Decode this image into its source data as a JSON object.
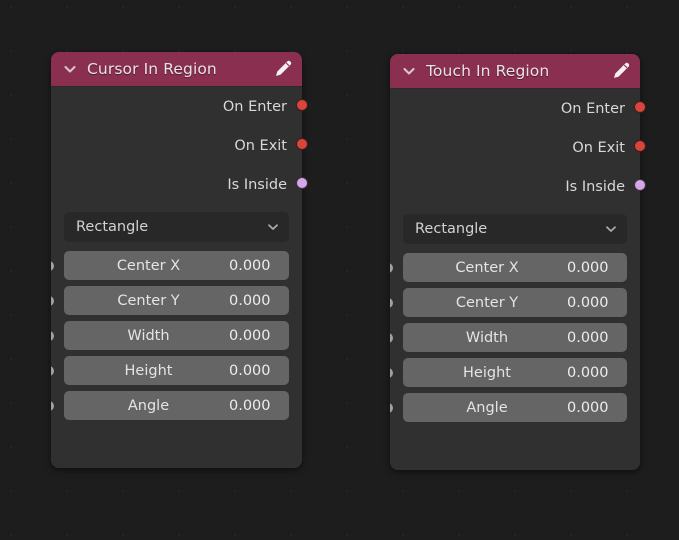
{
  "editor": {
    "background_color": "#1d1d1d",
    "type": "node-editor"
  },
  "colors": {
    "header": "#8a2f50",
    "node_body": "#303030",
    "socket_event": "#d9453c",
    "socket_boolean": "#d6a6e8",
    "socket_value": "#a1a1a1",
    "field": "#656565",
    "dropdown": "#282828"
  },
  "nodes": [
    {
      "title": "Cursor In Region",
      "collapse_icon": "chevron-down-icon",
      "edit_icon": "pencil-icon",
      "outputs": [
        {
          "label": "On Enter",
          "socket_color": "#d9453c"
        },
        {
          "label": "On Exit",
          "socket_color": "#d9453c"
        },
        {
          "label": "Is Inside",
          "socket_color": "#d6a6e8"
        }
      ],
      "dropdown": {
        "value": "Rectangle",
        "chevron": "chevron-down-icon"
      },
      "fields": [
        {
          "name": "Center X",
          "value": "0.000",
          "socket_color": "#a1a1a1"
        },
        {
          "name": "Center Y",
          "value": "0.000",
          "socket_color": "#a1a1a1"
        },
        {
          "name": "Width",
          "value": "0.000",
          "socket_color": "#a1a1a1"
        },
        {
          "name": "Height",
          "value": "0.000",
          "socket_color": "#a1a1a1"
        },
        {
          "name": "Angle",
          "value": "0.000",
          "socket_color": "#a1a1a1"
        }
      ]
    },
    {
      "title": "Touch In Region",
      "collapse_icon": "chevron-down-icon",
      "edit_icon": "pencil-icon",
      "outputs": [
        {
          "label": "On Enter",
          "socket_color": "#d9453c"
        },
        {
          "label": "On Exit",
          "socket_color": "#d9453c"
        },
        {
          "label": "Is Inside",
          "socket_color": "#d6a6e8"
        }
      ],
      "dropdown": {
        "value": "Rectangle",
        "chevron": "chevron-down-icon"
      },
      "fields": [
        {
          "name": "Center X",
          "value": "0.000",
          "socket_color": "#a1a1a1"
        },
        {
          "name": "Center Y",
          "value": "0.000",
          "socket_color": "#a1a1a1"
        },
        {
          "name": "Width",
          "value": "0.000",
          "socket_color": "#a1a1a1"
        },
        {
          "name": "Height",
          "value": "0.000",
          "socket_color": "#a1a1a1"
        },
        {
          "name": "Angle",
          "value": "0.000",
          "socket_color": "#a1a1a1"
        }
      ]
    }
  ]
}
